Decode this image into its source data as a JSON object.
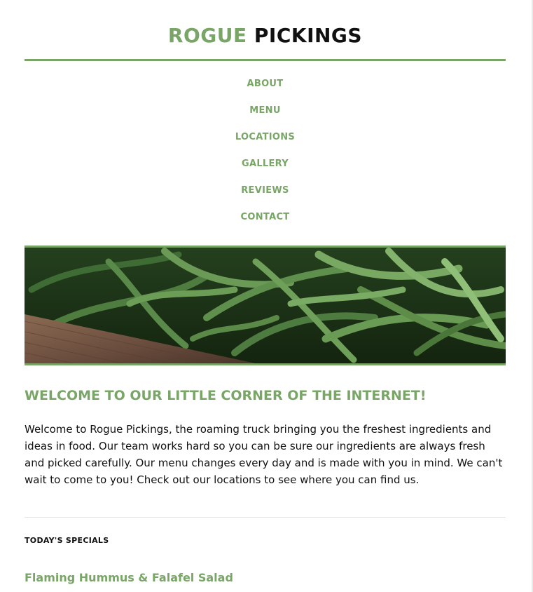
{
  "site": {
    "title_first": "ROGUE",
    "title_second": "PICKINGS"
  },
  "nav": {
    "items": [
      {
        "label": "ABOUT"
      },
      {
        "label": "MENU"
      },
      {
        "label": "LOCATIONS"
      },
      {
        "label": "GALLERY"
      },
      {
        "label": "REVIEWS"
      },
      {
        "label": "CONTACT"
      }
    ]
  },
  "hero": {
    "subject": "green beans in wooden crate"
  },
  "welcome": {
    "heading": "WELCOME TO OUR LITTLE CORNER OF THE INTERNET!",
    "body": "Welcome to Rogue Pickings, the roaming truck bringing you the freshest ingredients and ideas in food. Our team works hard so you can be sure our ingredients are always fresh and picked carefully. Our menu changes every day and is made with you in mind. We can't wait to come to you! Check out our locations to see where you can find us."
  },
  "specials": {
    "heading": "TODAY'S SPECIALS",
    "first_item": "Flaming Hummus & Falafel Salad"
  },
  "colors": {
    "accent": "#79a667",
    "text": "#111111",
    "divider": "#e6e6e6"
  }
}
